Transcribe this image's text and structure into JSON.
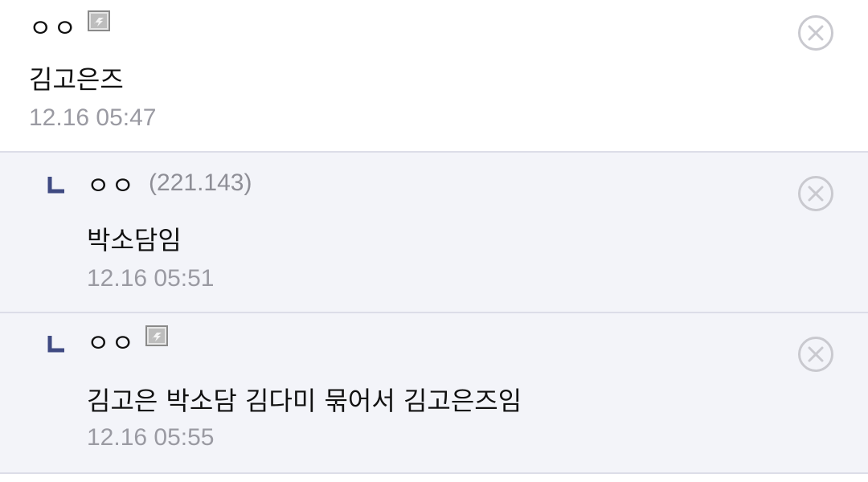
{
  "colors": {
    "reply_background": "#f3f4f9",
    "divider": "#dcdde8",
    "reply_arrow": "#3f4a82",
    "timestamp": "#9a9aa2",
    "delete_icon": "#c9c9cf"
  },
  "comments": [
    {
      "nickname": "ㅇㅇ",
      "fixed_badge_icon": "fixed-nickname-badge-icon",
      "text": "김고은즈",
      "time": "12.16 05:47",
      "delete_icon": "circle-x-icon"
    },
    {
      "nickname": "ㅇㅇ",
      "ip": "(221.143)",
      "text": "박소담임",
      "time": "12.16 05:51",
      "reply_icon": "reply-arrow-icon",
      "delete_icon": "circle-x-icon"
    },
    {
      "nickname": "ㅇㅇ",
      "fixed_badge_icon": "fixed-nickname-badge-icon",
      "text": "김고은 박소담 김다미 묶어서 김고은즈임",
      "time": "12.16 05:55",
      "reply_icon": "reply-arrow-icon",
      "delete_icon": "circle-x-icon"
    }
  ]
}
